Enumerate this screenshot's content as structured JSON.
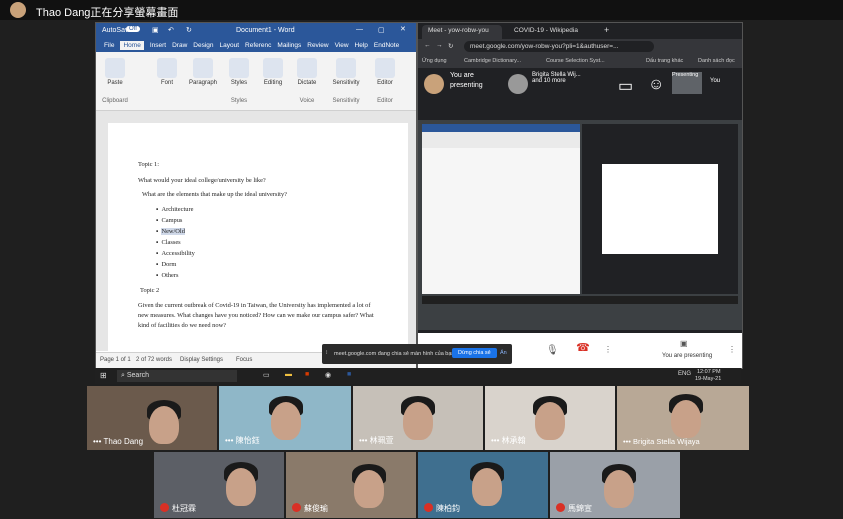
{
  "topbar": {
    "presenter": "Thao Dang正在分享螢幕畫面"
  },
  "word": {
    "autosave": "AutoSave",
    "autosave_state": "Off",
    "doc_title": "Document1 - Word",
    "tabs": [
      "File",
      "Home",
      "Insert",
      "Draw",
      "Design",
      "Layout",
      "Referenc",
      "Mailings",
      "Review",
      "View",
      "Help",
      "EndNote"
    ],
    "ribbon": {
      "paste": "Paste",
      "font": "Font",
      "paragraph": "Paragraph",
      "styles": "Styles",
      "editing": "Editing",
      "dictate": "Dictate",
      "sensitivity": "Sensitivity",
      "editor": "Editor",
      "clipboard": "Clipboard",
      "styles_group": "Styles",
      "voice": "Voice",
      "sensitivity_group": "Sensitivity",
      "editor_group": "Editor"
    },
    "doc": {
      "topic1": "Topic 1:",
      "q1": "What would your ideal college/university be like?",
      "q2": "What are the elements that make up the ideal university?",
      "items": [
        "Architecture",
        "Campus",
        "New/Old",
        "Classes",
        "Accessibility",
        "Dorm",
        "Others"
      ],
      "topic2": "Topic 2",
      "para": "Given the current outbreak of Covid-19 in Taiwan, the University has implemented a lot of new measures. What changes have you noticed? How can we make our campus safer? What kind of facilities do we need now?"
    },
    "status": {
      "page": "Page 1 of 1",
      "words": "2 of 72 words",
      "display": "Display Settings",
      "focus": "Focus"
    }
  },
  "chrome": {
    "tab1": "Meet - yow-robw-you",
    "tab2": "COVID-19 - Wikipedia",
    "url": "meet.google.com/yow-robw-you?pli=1&authuser=...",
    "bookmarks": [
      "Ứng dụng",
      "Cambridge Dictionary...",
      "Course Selection Syst...",
      "Dấu trang khác",
      "Danh sách đọc"
    ],
    "meet": {
      "presenting_line1": "You are",
      "presenting_line2": "presenting",
      "others": "Brigita Stella Wij... and 10 more",
      "you_label": "You",
      "presenting_label": "Presenting",
      "bottom_presenting": "You are presenting"
    }
  },
  "sharebar": {
    "text": "meet.google.com đang chia sẻ màn hình của bạn.",
    "stop": "Dừng chia sẻ",
    "hide": "Ẩn"
  },
  "taskbar": {
    "search": "Search",
    "lang": "ENG",
    "time": "12:07 PM",
    "date": "19-May-21"
  },
  "participants": [
    {
      "name": "Thao Dang",
      "muted": false
    },
    {
      "name": "陳怡鈺",
      "muted": false
    },
    {
      "name": "林珮萱",
      "muted": false
    },
    {
      "name": "林承翰",
      "muted": false
    },
    {
      "name": "Brigita Stella Wijaya",
      "muted": false
    },
    {
      "name": "杜冠霖",
      "muted": true
    },
    {
      "name": "蘇俊瑜",
      "muted": true
    },
    {
      "name": "陳柏鈞",
      "muted": true
    },
    {
      "name": "馬錦宣",
      "muted": true
    }
  ],
  "colors": {
    "word_blue": "#2b579a",
    "meet_dark": "#202124",
    "mute_red": "#d93025",
    "stop_share_blue": "#1a73e8"
  }
}
